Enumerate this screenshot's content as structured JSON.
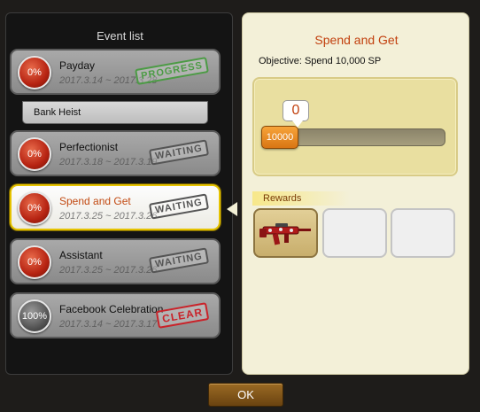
{
  "left_panel": {
    "title": "Event list",
    "events": [
      {
        "name": "Payday",
        "date": "2017.3.14 ~ 2017.3.28",
        "percent": "0%",
        "status": "PROGRESS"
      },
      {
        "name": "Perfectionist",
        "date": "2017.3.18 ~ 2017.3.19",
        "percent": "0%",
        "status": "WAITING"
      },
      {
        "name": "Spend and Get",
        "date": "2017.3.25 ~ 2017.3.26",
        "percent": "0%",
        "status": "WAITING"
      },
      {
        "name": "Assistant",
        "date": "2017.3.25 ~ 2017.3.26",
        "percent": "0%",
        "status": "WAITING"
      },
      {
        "name": "Facebook Celebration",
        "date": "2017.3.14 ~ 2017.3.17",
        "percent": "100%",
        "status": "CLEAR"
      }
    ],
    "sub_item": "Bank Heist"
  },
  "detail": {
    "title": "Spend and Get",
    "objective": "Objective: Spend 10,000 SP",
    "current_value": "0",
    "target_value": "10000",
    "progress_fraction": 0,
    "rewards_label": "Rewards",
    "rewards": [
      {
        "icon": "assault-rifle-icon"
      },
      {
        "icon": ""
      },
      {
        "icon": ""
      }
    ]
  },
  "footer": {
    "ok_label": "OK"
  },
  "colors": {
    "selected_border": "#e6c300",
    "title_accent": "#c2410f",
    "progress_stamp": "#4c9b45",
    "clear_stamp": "#c9232a"
  }
}
